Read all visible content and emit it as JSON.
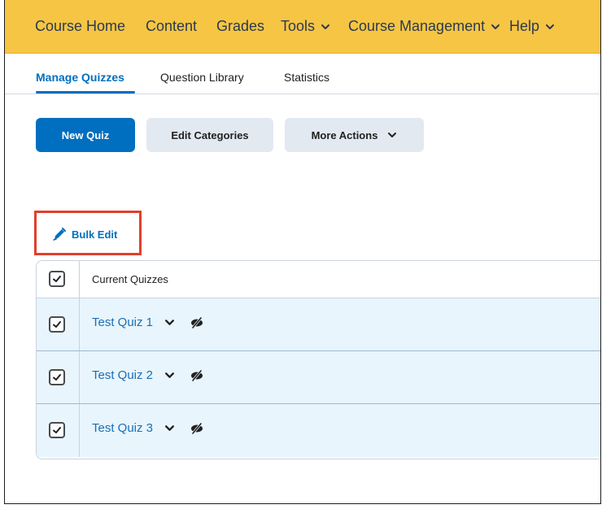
{
  "navbar": {
    "items": [
      {
        "label": "Course Home",
        "dropdown": false
      },
      {
        "label": "Content",
        "dropdown": false
      },
      {
        "label": "Grades",
        "dropdown": false
      },
      {
        "label": "Tools",
        "dropdown": true
      },
      {
        "label": "Course Management",
        "dropdown": true
      },
      {
        "label": "Help",
        "dropdown": true
      }
    ]
  },
  "subtabs": [
    {
      "label": "Manage Quizzes",
      "active": true
    },
    {
      "label": "Question Library",
      "active": false
    },
    {
      "label": "Statistics",
      "active": false
    }
  ],
  "toolbar": {
    "new_quiz_label": "New Quiz",
    "edit_categories_label": "Edit Categories",
    "more_actions_label": "More Actions"
  },
  "bulk_edit": {
    "label": "Bulk Edit"
  },
  "table": {
    "header": "Current Quizzes",
    "header_checked": true,
    "rows": [
      {
        "name": "Test Quiz 1",
        "checked": true
      },
      {
        "name": "Test Quiz 2",
        "checked": true
      },
      {
        "name": "Test Quiz 3",
        "checked": true
      }
    ]
  },
  "colors": {
    "navbar_bg": "#f6c544",
    "primary": "#006fbf",
    "highlight_border": "#e0402c",
    "selected_row_bg": "#e8f5fc"
  },
  "icons": {
    "dropdown": "chevron-down-icon",
    "bulk_edit": "pencil-icon",
    "visibility": "hidden-eye-icon",
    "checkbox": "checkmark-icon"
  }
}
